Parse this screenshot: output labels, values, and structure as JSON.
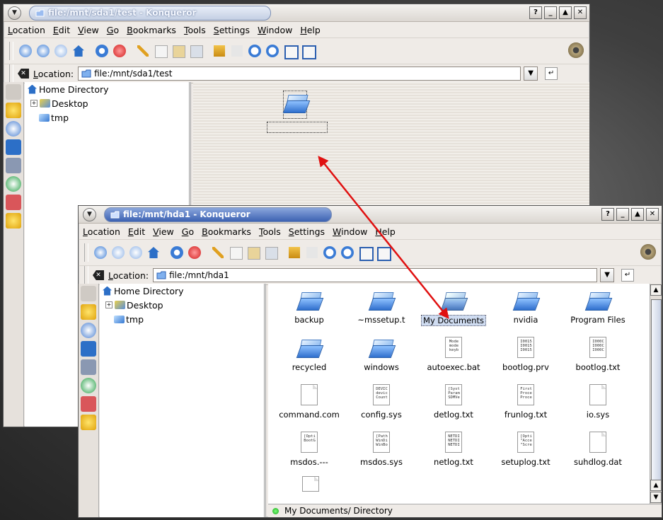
{
  "colors": {
    "accent": "#3d62b2",
    "arrow": "#e01010",
    "selection": "#cfdcf1"
  },
  "window_back": {
    "title": "file:/mnt/sda1/test - Konqueror",
    "location_label": "Location:",
    "location_value": "file:/mnt/sda1/test",
    "menu": [
      "Location",
      "Edit",
      "View",
      "Go",
      "Bookmarks",
      "Tools",
      "Settings",
      "Window",
      "Help"
    ],
    "tree": [
      {
        "label": "Home Directory",
        "icon": "home-icon"
      },
      {
        "label": "Desktop",
        "icon": "desktop-folder-icon",
        "expandable": true
      },
      {
        "label": "tmp",
        "icon": "folder-icon"
      }
    ]
  },
  "window_front": {
    "title": "file:/mnt/hda1 - Konqueror",
    "location_label": "Location:",
    "location_value": "file:/mnt/hda1",
    "menu": [
      "Location",
      "Edit",
      "View",
      "Go",
      "Bookmarks",
      "Tools",
      "Settings",
      "Window",
      "Help"
    ],
    "tree": [
      {
        "label": "Home Directory",
        "icon": "home-icon"
      },
      {
        "label": "Desktop",
        "icon": "desktop-folder-icon",
        "expandable": true
      },
      {
        "label": "tmp",
        "icon": "folder-icon"
      }
    ],
    "files": [
      {
        "name": "backup",
        "kind": "folder"
      },
      {
        "name": "~mssetup.t",
        "kind": "folder"
      },
      {
        "name": "My Documents",
        "kind": "folder",
        "selected": true
      },
      {
        "name": "nvidia",
        "kind": "folder"
      },
      {
        "name": "Program Files",
        "kind": "folder"
      },
      {
        "name": "recycled",
        "kind": "folder"
      },
      {
        "name": "windows",
        "kind": "folder"
      },
      {
        "name": "autoexec.bat",
        "kind": "text",
        "preview": "Mode\nmode\nkeyb"
      },
      {
        "name": "bootlog.prv",
        "kind": "text",
        "preview": "I0015\nI0015\nI0015"
      },
      {
        "name": "bootlog.txt",
        "kind": "text",
        "preview": "I000C\nI000C\nI000C"
      },
      {
        "name": "command.com",
        "kind": "blank"
      },
      {
        "name": "config.sys",
        "kind": "text",
        "preview": "DEVIC\ndevic\nCount"
      },
      {
        "name": "detlog.txt",
        "kind": "text",
        "preview": "[Syst\nParam\nSDMVe"
      },
      {
        "name": "frunlog.txt",
        "kind": "text",
        "preview": "First\nProce\nProce"
      },
      {
        "name": "io.sys",
        "kind": "blank"
      },
      {
        "name": "msdos.---",
        "kind": "text",
        "preview": "[Opti\nBootG"
      },
      {
        "name": "msdos.sys",
        "kind": "text",
        "preview": "[Path\nWinDi\nWinBo"
      },
      {
        "name": "netlog.txt",
        "kind": "text",
        "preview": "NETDI\nNETDI\nNETDI"
      },
      {
        "name": "setuplog.txt",
        "kind": "text",
        "preview": "[Opti\n\"Acce\n\"Scre"
      },
      {
        "name": "suhdlog.dat",
        "kind": "blank"
      }
    ],
    "status_text": "My Documents/  Directory"
  }
}
